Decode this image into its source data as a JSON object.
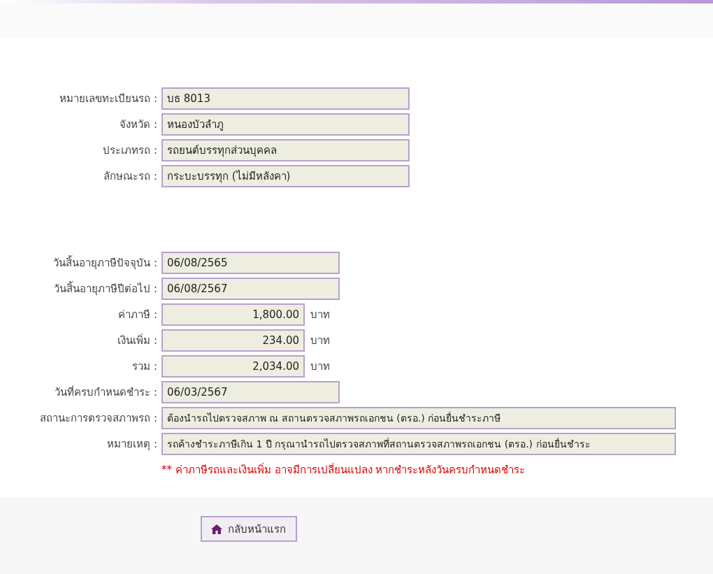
{
  "groups": [
    {
      "fields": [
        {
          "label": "หมายเลขทะเบียนรถ :",
          "value": "บธ 8013",
          "kind": "medium"
        },
        {
          "label": "จังหวัด :",
          "value": "หนองบัวลำภู",
          "kind": "medium"
        },
        {
          "label": "ประเภทรถ :",
          "value": "รถยนต์บรรทุกส่วนบุคคล",
          "kind": "medium"
        },
        {
          "label": "ลักษณะรถ :",
          "value": "กระบะบรรทุก (ไม่มีหลังคา)",
          "kind": "medium"
        }
      ]
    },
    {
      "fields": [
        {
          "label": "วันสิ้นอายุภาษีปัจจุบัน :",
          "value": "06/08/2565",
          "kind": "date"
        },
        {
          "label": "วันสิ้นอายุภาษีปีต่อไป :",
          "value": "06/08/2567",
          "kind": "date"
        },
        {
          "label": "ค่าภาษี :",
          "value": "1,800.00",
          "kind": "amount",
          "unit": "บาท"
        },
        {
          "label": "เงินเพิ่ม :",
          "value": "234.00",
          "kind": "amount",
          "unit": "บาท"
        },
        {
          "label": "รวม :",
          "value": "2,034.00",
          "kind": "amount",
          "unit": "บาท"
        },
        {
          "label": "วันที่ครบกำหนดชำระ :",
          "value": "06/03/2567",
          "kind": "date"
        },
        {
          "label": "สถานะการตรวจสภาพรถ :",
          "value": "ต้องนำรถไปตรวจสภาพ ณ สถานตรวจสภาพรถเอกชน (ตรอ.) ก่อนยื่นชำระภาษี",
          "kind": "long"
        },
        {
          "label": "หมายเหตุ :",
          "value": "รถค้างชำระภาษีเกิน 1 ปี กรุณานำรถไปตรวจสภาพที่สถานตรวจสภาพรถเอกชน (ตรอ.) ก่อนยื่นชำระ",
          "kind": "long"
        }
      ],
      "note": "** ค่าภาษีรถและเงินเพิ่ม อาจมีการเปลี่ยนแปลง หากชำระหลังวันครบกำหนดชำระ"
    }
  ],
  "home_button": "กลับหน้าแรก"
}
